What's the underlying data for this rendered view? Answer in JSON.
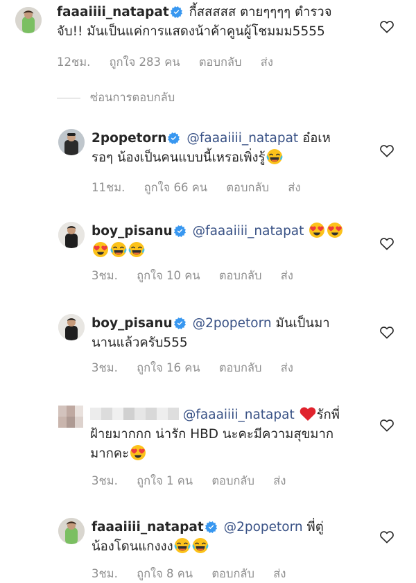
{
  "hide_replies_label": "ซ่อนการตอบกลับ",
  "comments": [
    {
      "username": "faaaiiii_natapat",
      "mention": "",
      "line1": "กี้สสสสส ตายๆๆๆๆ ตำรวจ",
      "line2": "จับ!! มันเป็นแค่การแสดงน้าค้าคูนผู้โชมมม5555",
      "time": "12ชม.",
      "likes": "ถูกใจ 283 คน",
      "reply": "ตอบกลับ",
      "send": "ส่ง"
    },
    {
      "username": "2popetorn",
      "mention": "@faaaiiii_natapat",
      "line1": "อ๋อเห",
      "line2": "รอๆ น้องเป็นคนแบบนี้เหรอเพิ่งรู้",
      "time": "11ชม.",
      "likes": "ถูกใจ 66 คน",
      "reply": "ตอบกลับ",
      "send": "ส่ง"
    },
    {
      "username": "boy_pisanu",
      "mention": "@faaaiiii_natapat",
      "line1": "",
      "line2": "",
      "time": "3ชม.",
      "likes": "ถูกใจ 10 คน",
      "reply": "ตอบกลับ",
      "send": "ส่ง"
    },
    {
      "username": "boy_pisanu",
      "mention": "@2popetorn",
      "line1": "มันเป็นมา",
      "line2": "นานแล้วครับ555",
      "time": "3ชม.",
      "likes": "ถูกใจ 16 คน",
      "reply": "ตอบกลับ",
      "send": "ส่ง"
    },
    {
      "username": "",
      "mention": "@faaaiiii_natapat",
      "line1": "รักพี่",
      "line2": "ฝ้ายมากกก น่ารัก HBD นะคะมีความสุขมาก",
      "line3": "มากคะ",
      "time": "3ชม.",
      "likes": "ถูกใจ 1 คน",
      "reply": "ตอบกลับ",
      "send": "ส่ง"
    },
    {
      "username": "faaaiiii_natapat",
      "mention": "@2popetorn",
      "line1": "พี่ตู่",
      "line2": "น้องโดนแกงงง",
      "time": "3ชม.",
      "likes": "ถูกใจ 8 คน",
      "reply": "ตอบกลับ",
      "send": "ส่ง"
    }
  ],
  "colors": {
    "text": "#262626",
    "meta": "#8e8e8e",
    "mention": "#385185",
    "verified": "#3897f0"
  },
  "icons": [
    "verified-badge-icon",
    "heart-outline-icon",
    "laughing-tears-emoji",
    "heart-eyes-emoji",
    "red-heart-emoji"
  ]
}
